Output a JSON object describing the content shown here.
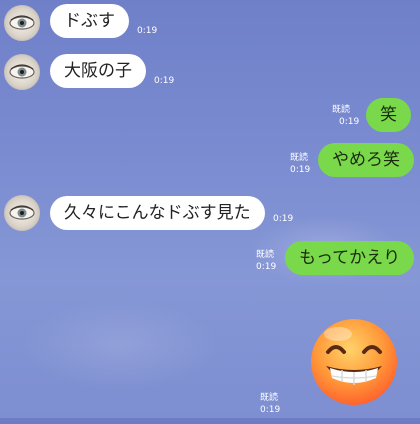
{
  "messages": [
    {
      "side": "in",
      "text": "ドぶす",
      "time": "0:19"
    },
    {
      "side": "in",
      "text": "大阪の子",
      "time": "0:19"
    },
    {
      "side": "out",
      "text": "笑",
      "read": "既読",
      "time": "0:19"
    },
    {
      "side": "out",
      "text": "やめろ笑",
      "read": "既読",
      "time": "0:19"
    },
    {
      "side": "in",
      "text": "久々にこんなドぶす見た",
      "time": "0:19"
    },
    {
      "side": "out",
      "text": "もってかえり",
      "read": "既読",
      "time": "0:19"
    },
    {
      "side": "out",
      "sticker": "grinning-face-sticker",
      "read": "既読",
      "time": "0:19"
    }
  ],
  "colors": {
    "background": "#7a8bd0",
    "incoming_bubble": "#ffffff",
    "outgoing_bubble": "#79d94a"
  }
}
